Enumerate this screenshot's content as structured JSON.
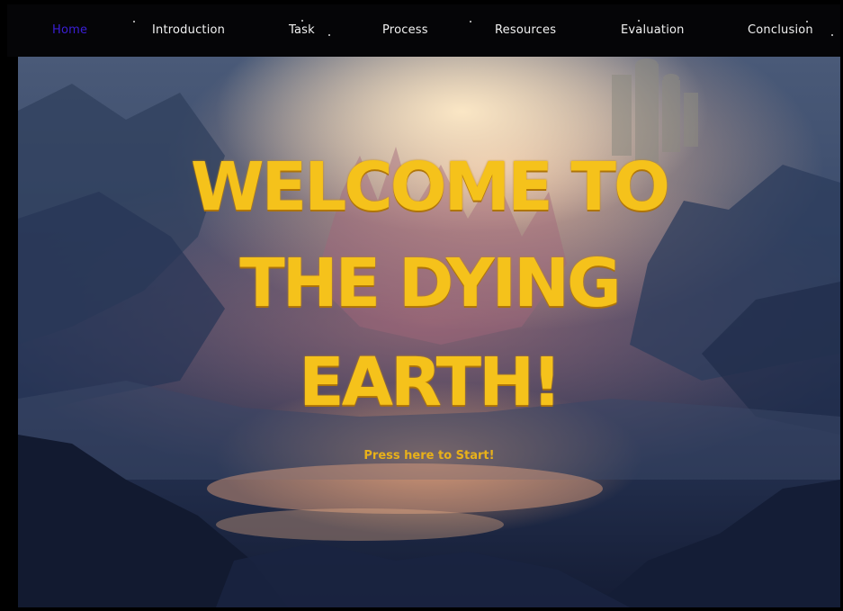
{
  "nav": {
    "items": [
      {
        "label": "Home",
        "active": true
      },
      {
        "label": "Introduction",
        "active": false
      },
      {
        "label": "Task",
        "active": false
      },
      {
        "label": "Process",
        "active": false
      },
      {
        "label": "Resources",
        "active": false
      },
      {
        "label": "Evaluation",
        "active": false
      },
      {
        "label": "Conclusion",
        "active": false
      }
    ],
    "active_color": "#3b1fd6",
    "text_color": "#f2f2f2"
  },
  "hero": {
    "headline_line1": "WELCOME TO",
    "headline_line2": "THE DYING",
    "headline_line3": "EARTH!",
    "start_label": "Press here to Start!",
    "accent_color": "#f5c21b"
  }
}
